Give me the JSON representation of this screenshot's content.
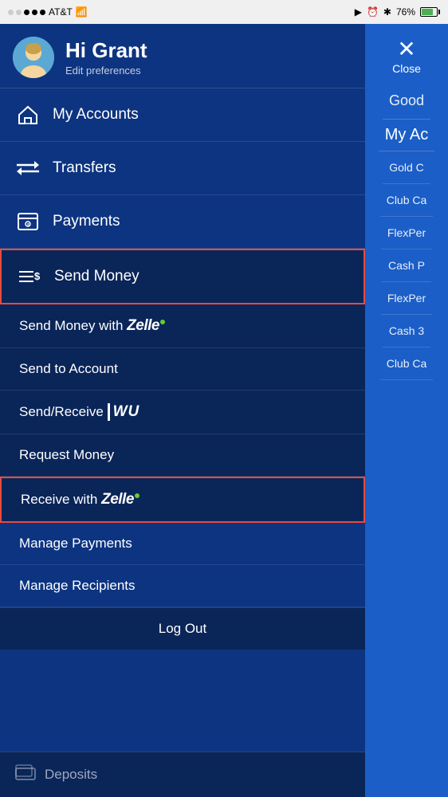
{
  "statusBar": {
    "carrier": "AT&T",
    "wifi": true,
    "battery": "76%",
    "time_icon": "clock"
  },
  "leftPanel": {
    "user": {
      "greeting": "Hi Grant",
      "subtext": "Edit preferences"
    },
    "menuItems": [
      {
        "id": "my-accounts",
        "label": "My Accounts",
        "icon": "home"
      },
      {
        "id": "transfers",
        "label": "Transfers",
        "icon": "transfer"
      },
      {
        "id": "payments",
        "label": "Payments",
        "icon": "payments"
      }
    ],
    "sendMoneySection": {
      "label": "Send Money",
      "icon": "send-money",
      "highlighted": true
    },
    "subMenuItems": [
      {
        "id": "send-zelle",
        "label": "Send Money with",
        "brand": "Zelle",
        "highlighted": false
      },
      {
        "id": "send-account",
        "label": "Send to Account",
        "highlighted": false
      },
      {
        "id": "send-wu",
        "label": "Send/Receive",
        "brand": "WU",
        "highlighted": false
      },
      {
        "id": "request-money",
        "label": "Request Money",
        "highlighted": false
      },
      {
        "id": "receive-zelle",
        "label": "Receive with",
        "brand": "Zelle",
        "highlighted": true
      }
    ],
    "bottomItems": [
      {
        "id": "manage-payments",
        "label": "Manage Payments"
      },
      {
        "id": "manage-recipients",
        "label": "Manage Recipients"
      }
    ],
    "logoutLabel": "Log Out",
    "depositsLabel": "Deposits"
  },
  "rightPanel": {
    "closeLabel": "Close",
    "greeting": "Good",
    "sectionTitle": "My Ac",
    "items": [
      "Gold C",
      "Club Ca",
      "FlexPer",
      "Cash P",
      "FlexPer",
      "Cash 3",
      "Club Ca"
    ]
  }
}
